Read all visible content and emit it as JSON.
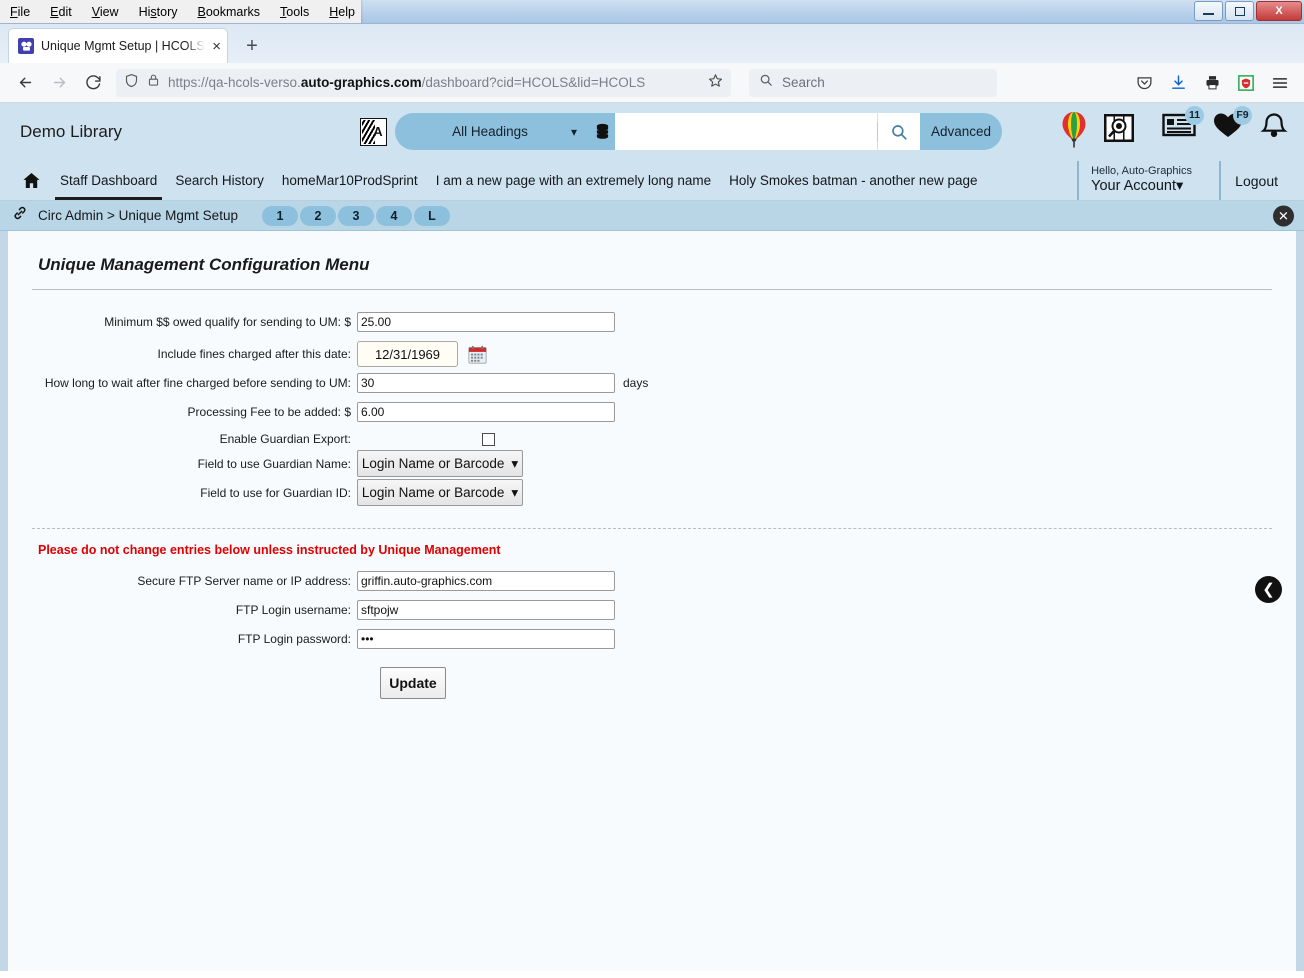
{
  "window": {
    "menus": [
      "File",
      "Edit",
      "View",
      "History",
      "Bookmarks",
      "Tools",
      "Help"
    ],
    "minimize_label": "Minimize",
    "maximize_label": "Maximize",
    "close_label": "X"
  },
  "browser": {
    "tab": {
      "title": "Unique Mgmt Setup | HCOLS | H",
      "favicon_name": "verso-favicon",
      "close_label": "×"
    },
    "new_tab_label": "+",
    "back_label": "←",
    "forward_label": "→",
    "reload_label": "⟳",
    "url": {
      "scheme": "https://qa-hcols-verso.",
      "domain": "auto-graphics.com",
      "path": "/dashboard?cid=HCOLS&lid=HCOLS"
    },
    "bookmark_label": "☆",
    "search_placeholder": "Search",
    "icons": [
      "pocket-icon",
      "downloads-icon",
      "print-icon",
      "adblock-icon",
      "hamburger-menu-icon"
    ]
  },
  "header": {
    "library_name": "Demo Library",
    "lang_icon_letter": "A",
    "headings_select": "All Headings",
    "database_icon": "database-icon",
    "query_value": "",
    "search_button_label": "search-icon",
    "advanced_label": "Advanced",
    "icons": [
      {
        "name": "balloon-icon",
        "badge": ""
      },
      {
        "name": "magnify-book-icon",
        "badge": ""
      },
      {
        "name": "lists-icon",
        "badge": "11"
      },
      {
        "name": "favorites-heart-icon",
        "badge": "F9"
      },
      {
        "name": "notifications-bell-icon",
        "badge": ""
      }
    ]
  },
  "nav": {
    "home_icon": "home-icon",
    "items": [
      {
        "label": "Staff Dashboard",
        "active": true
      },
      {
        "label": "Search History",
        "active": false
      },
      {
        "label": "homeMar10ProdSprint",
        "active": false
      },
      {
        "label": "I am a new page with an extremely long name",
        "active": false
      },
      {
        "label": "Holy Smokes batman - another new page",
        "active": false
      }
    ],
    "account_hello": "Hello, Auto-Graphics",
    "account_name": "Your Account",
    "account_chevron": "⌄",
    "logout": "Logout"
  },
  "breadcrumb": {
    "link_icon": "chain-link-icon",
    "text": "Circ Admin > Unique Mgmt Setup",
    "steps": [
      "1",
      "2",
      "3",
      "4",
      "L"
    ],
    "close_label": "✕"
  },
  "form": {
    "title": "Unique Management Configuration Menu",
    "rows": [
      {
        "label": "Minimum $$ owed qualify for sending to UM: $",
        "value": "25.00",
        "suffix": ""
      },
      {
        "label": "Include fines charged after this date:",
        "value": "12/31/1969",
        "suffix": ""
      },
      {
        "label": "How long to wait after fine charged before sending to UM:",
        "value": "30",
        "suffix": "days"
      },
      {
        "label": "Processing Fee to be added: $",
        "value": "6.00",
        "suffix": ""
      }
    ],
    "calendar_icon": "calendar-icon",
    "guardian_export_label": "Enable Guardian Export:",
    "guardian_export_checked": false,
    "guardian_name_label": "Field to use Guardian Name:",
    "guardian_name_value": "Login Name or Barcode",
    "guardian_id_label": "Field to use for Guardian ID:",
    "guardian_id_value": "Login Name or Barcode",
    "warning": "Please do not change entries below unless instructed by Unique Management",
    "ftp_rows": [
      {
        "label": "Secure FTP Server name or IP address:",
        "value": "griffin.auto-graphics.com"
      },
      {
        "label": "FTP Login username:",
        "value": "sftpojw"
      },
      {
        "label": "FTP Login password:",
        "value": "•••"
      }
    ],
    "update_label": "Update",
    "back_fab_label": "❮"
  }
}
